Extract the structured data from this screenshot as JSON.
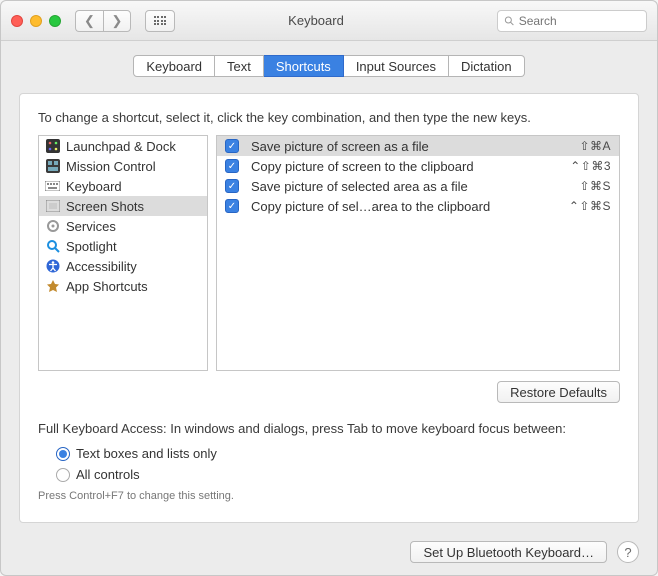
{
  "window": {
    "title": "Keyboard"
  },
  "search": {
    "placeholder": "Search"
  },
  "tabs": [
    {
      "label": "Keyboard",
      "active": false
    },
    {
      "label": "Text",
      "active": false
    },
    {
      "label": "Shortcuts",
      "active": true
    },
    {
      "label": "Input Sources",
      "active": false
    },
    {
      "label": "Dictation",
      "active": false
    }
  ],
  "instructions": "To change a shortcut, select it, click the key combination, and then type the new keys.",
  "categories": [
    {
      "label": "Launchpad & Dock",
      "icon": "launchpad",
      "selected": false
    },
    {
      "label": "Mission Control",
      "icon": "mission-control",
      "selected": false
    },
    {
      "label": "Keyboard",
      "icon": "keyboard",
      "selected": false
    },
    {
      "label": "Screen Shots",
      "icon": "screenshots",
      "selected": true
    },
    {
      "label": "Services",
      "icon": "services",
      "selected": false
    },
    {
      "label": "Spotlight",
      "icon": "spotlight",
      "selected": false
    },
    {
      "label": "Accessibility",
      "icon": "accessibility",
      "selected": false
    },
    {
      "label": "App Shortcuts",
      "icon": "app-shortcuts",
      "selected": false
    }
  ],
  "shortcuts": [
    {
      "enabled": true,
      "label": "Save picture of screen as a file",
      "keys": "⇧⌘A",
      "selected": true
    },
    {
      "enabled": true,
      "label": "Copy picture of screen to the clipboard",
      "keys": "⌃⇧⌘3",
      "selected": false
    },
    {
      "enabled": true,
      "label": "Save picture of selected area as a file",
      "keys": "⇧⌘S",
      "selected": false
    },
    {
      "enabled": true,
      "label": "Copy picture of sel…area to the clipboard",
      "keys": "⌃⇧⌘S",
      "selected": false
    }
  ],
  "restore_defaults": "Restore Defaults",
  "full_keyboard_access": {
    "label": "Full Keyboard Access: In windows and dialogs, press Tab to move keyboard focus between:",
    "options": [
      {
        "label": "Text boxes and lists only",
        "checked": true
      },
      {
        "label": "All controls",
        "checked": false
      }
    ],
    "hint": "Press Control+F7 to change this setting."
  },
  "bluetooth_button": "Set Up Bluetooth Keyboard…",
  "icons": {
    "colors": {
      "launchpad": "#4a4a4a",
      "mission-control": "#5a5a5a",
      "keyboard": "#888",
      "screenshots": "#8a8a8a",
      "services": "#999",
      "spotlight": "#1c8fe0",
      "accessibility": "#2f66d6",
      "app-shortcuts": "#c28a2e"
    }
  }
}
